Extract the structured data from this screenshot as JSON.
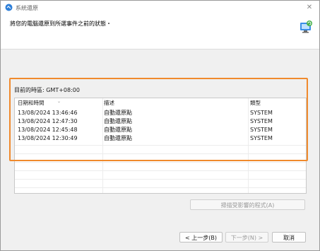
{
  "window": {
    "title": "系統還原",
    "instruction": "將您的電腦還原到所選事件之前的狀態・"
  },
  "timezone_label": "目前的時區: GMT+08:00",
  "table": {
    "columns": [
      "日期和時間",
      "描述",
      "類型"
    ],
    "rows": [
      {
        "datetime": "13/08/2024 13:46:46",
        "description": "自動還原點",
        "type": "SYSTEM"
      },
      {
        "datetime": "13/08/2024 12:47:30",
        "description": "自動還原點",
        "type": "SYSTEM"
      },
      {
        "datetime": "13/08/2024 12:45:48",
        "description": "自動還原點",
        "type": "SYSTEM"
      },
      {
        "datetime": "13/08/2024 12:30:49",
        "description": "自動還原點",
        "type": "SYSTEM"
      }
    ]
  },
  "buttons": {
    "scan": "掃描受影響的程式(A)",
    "back": "< 上一步(B)",
    "next": "下一步(N) >",
    "cancel": "取消"
  },
  "icons": {
    "title": "system-restore-icon",
    "header": "restore-computer-icon",
    "close": "close-icon"
  },
  "colors": {
    "highlight": "#f08a2c"
  }
}
